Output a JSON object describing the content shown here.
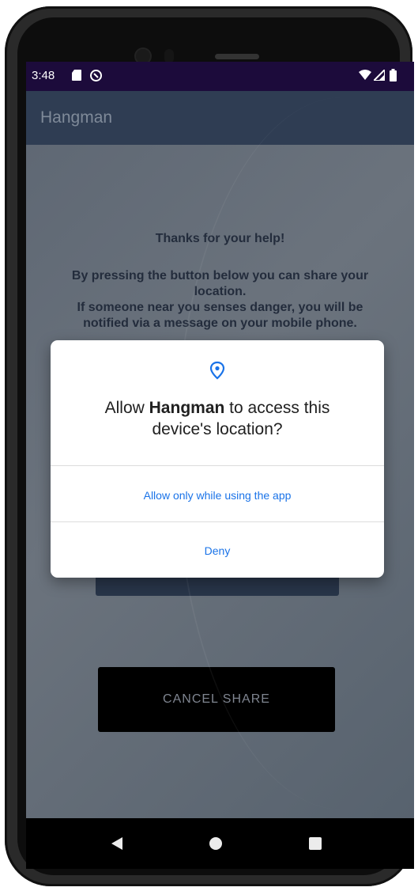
{
  "status_bar": {
    "time": "3:48",
    "icons": [
      "sd-card-icon",
      "sync-icon",
      "wifi-icon",
      "signal-icon",
      "battery-icon"
    ]
  },
  "app_bar": {
    "title": "Hangman"
  },
  "main": {
    "heading": "Thanks for your help!",
    "body_line1": "By pressing the button below you can share your",
    "body_line2": "location.",
    "body_line3": "If someone near you senses danger, you will be",
    "body_line4": "notified via a message on your mobile phone.",
    "cancel_button": "CANCEL SHARE"
  },
  "dialog": {
    "icon": "location-pin-icon",
    "title_prefix": "Allow ",
    "app_name": "Hangman",
    "title_suffix": " to access this",
    "title_line2": "device's location?",
    "option_allow": "Allow only while using the app",
    "option_deny": "Deny"
  },
  "nav_bar": {
    "icons": [
      "back-icon",
      "home-icon",
      "recents-icon"
    ]
  },
  "colors": {
    "status_bar": "#1c0b3b",
    "app_bar": "#2f3d53",
    "accent_link": "#1a73e8",
    "button_dark": "#000000"
  }
}
